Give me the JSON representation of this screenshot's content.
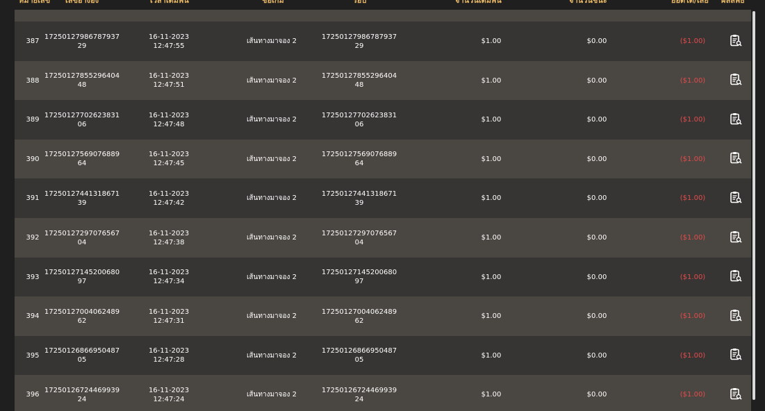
{
  "headers": {
    "no": "หมายเลข",
    "ref": "เลขอ้างอิง",
    "time": "เวลาเดิมพัน",
    "game": "ชื่อเกม",
    "round": "รอบ",
    "bet": "จำนวนเดิมพัน",
    "win": "จำนวนชนะ",
    "net": "ยอดได้/เสีย",
    "result": "ผลลัพธ์"
  },
  "rows": [
    {
      "no": "387",
      "ref": "1725012798678793729",
      "time": "16-11-2023 12:47:55",
      "game": "เส้นทางมาจอง 2",
      "round": "1725012798678793729",
      "bet": "$1.00",
      "win": "$0.00",
      "net": "($1.00)"
    },
    {
      "no": "388",
      "ref": "1725012785529640448",
      "time": "16-11-2023 12:47:51",
      "game": "เส้นทางมาจอง 2",
      "round": "1725012785529640448",
      "bet": "$1.00",
      "win": "$0.00",
      "net": "($1.00)"
    },
    {
      "no": "389",
      "ref": "1725012770262383106",
      "time": "16-11-2023 12:47:48",
      "game": "เส้นทางมาจอง 2",
      "round": "1725012770262383106",
      "bet": "$1.00",
      "win": "$0.00",
      "net": "($1.00)"
    },
    {
      "no": "390",
      "ref": "1725012756907688964",
      "time": "16-11-2023 12:47:45",
      "game": "เส้นทางมาจอง 2",
      "round": "1725012756907688964",
      "bet": "$1.00",
      "win": "$0.00",
      "net": "($1.00)"
    },
    {
      "no": "391",
      "ref": "1725012744131867139",
      "time": "16-11-2023 12:47:42",
      "game": "เส้นทางมาจอง 2",
      "round": "1725012744131867139",
      "bet": "$1.00",
      "win": "$0.00",
      "net": "($1.00)"
    },
    {
      "no": "392",
      "ref": "1725012729707656704",
      "time": "16-11-2023 12:47:38",
      "game": "เส้นทางมาจอง 2",
      "round": "1725012729707656704",
      "bet": "$1.00",
      "win": "$0.00",
      "net": "($1.00)"
    },
    {
      "no": "393",
      "ref": "1725012714520068097",
      "time": "16-11-2023 12:47:34",
      "game": "เส้นทางมาจอง 2",
      "round": "1725012714520068097",
      "bet": "$1.00",
      "win": "$0.00",
      "net": "($1.00)"
    },
    {
      "no": "394",
      "ref": "1725012700406248962",
      "time": "16-11-2023 12:47:31",
      "game": "เส้นทางมาจอง 2",
      "round": "1725012700406248962",
      "bet": "$1.00",
      "win": "$0.00",
      "net": "($1.00)"
    },
    {
      "no": "395",
      "ref": "1725012686695048705",
      "time": "16-11-2023 12:47:28",
      "game": "เส้นทางมาจอง 2",
      "round": "1725012686695048705",
      "bet": "$1.00",
      "win": "$0.00",
      "net": "($1.00)"
    },
    {
      "no": "396",
      "ref": "1725012672446993924",
      "time": "16-11-2023 12:47:24",
      "game": "เส้นทางมาจอง 2",
      "round": "1725012672446993924",
      "bet": "$1.00",
      "win": "$0.00",
      "net": "($1.00)"
    }
  ],
  "icons": {
    "result": "clipboard-search-icon"
  },
  "colors": {
    "header_text": "#e8b866",
    "loss": "#e34b4b",
    "row_alt": "#4a4641",
    "row_norm": "#373534"
  }
}
